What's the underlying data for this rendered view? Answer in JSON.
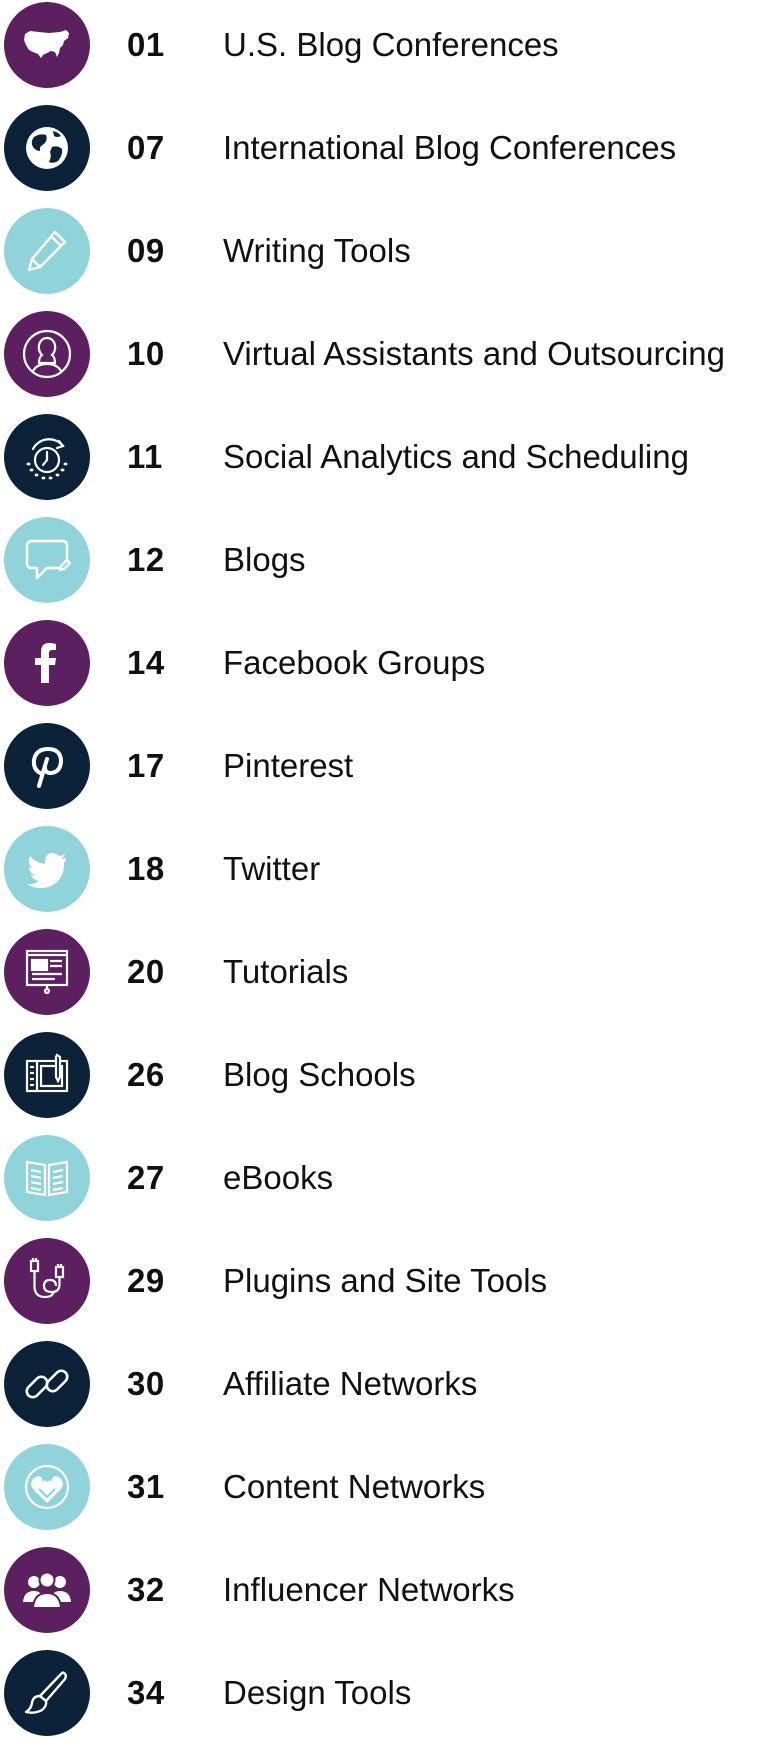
{
  "colors": {
    "purple": "#5c1f5f",
    "navy": "#0c2238",
    "teal": "#91d3db",
    "text": "#111111"
  },
  "entries": [
    {
      "page": "01",
      "title": "U.S. Blog Conferences",
      "icon": "usa-map-icon",
      "color": "purple"
    },
    {
      "page": "07",
      "title": "International Blog Conferences",
      "icon": "globe-icon",
      "color": "navy"
    },
    {
      "page": "09",
      "title": "Writing Tools",
      "icon": "pencil-icon",
      "color": "teal"
    },
    {
      "page": "10",
      "title": "Virtual Assistants and Outsourcing",
      "icon": "person-icon",
      "color": "purple"
    },
    {
      "page": "11",
      "title": "Social Analytics and Scheduling",
      "icon": "stopwatch-icon",
      "color": "navy"
    },
    {
      "page": "12",
      "title": "Blogs",
      "icon": "speech-bubble-pencil-icon",
      "color": "teal"
    },
    {
      "page": "14",
      "title": "Facebook Groups",
      "icon": "facebook-icon",
      "color": "purple"
    },
    {
      "page": "17",
      "title": "Pinterest",
      "icon": "pinterest-icon",
      "color": "navy"
    },
    {
      "page": "18",
      "title": "Twitter",
      "icon": "twitter-bird-icon",
      "color": "teal"
    },
    {
      "page": "20",
      "title": "Tutorials",
      "icon": "presentation-board-icon",
      "color": "purple"
    },
    {
      "page": "26",
      "title": "Blog Schools",
      "icon": "tablet-pen-icon",
      "color": "navy"
    },
    {
      "page": "27",
      "title": "eBooks",
      "icon": "open-book-icon",
      "color": "teal"
    },
    {
      "page": "29",
      "title": "Plugins and Site Tools",
      "icon": "cable-plug-icon",
      "color": "purple"
    },
    {
      "page": "30",
      "title": "Affiliate Networks",
      "icon": "chain-link-icon",
      "color": "navy"
    },
    {
      "page": "31",
      "title": "Content Networks",
      "icon": "heart-network-icon",
      "color": "teal"
    },
    {
      "page": "32",
      "title": "Influencer Networks",
      "icon": "group-people-icon",
      "color": "purple"
    },
    {
      "page": "34",
      "title": "Design Tools",
      "icon": "paintbrush-icon",
      "color": "navy"
    }
  ]
}
